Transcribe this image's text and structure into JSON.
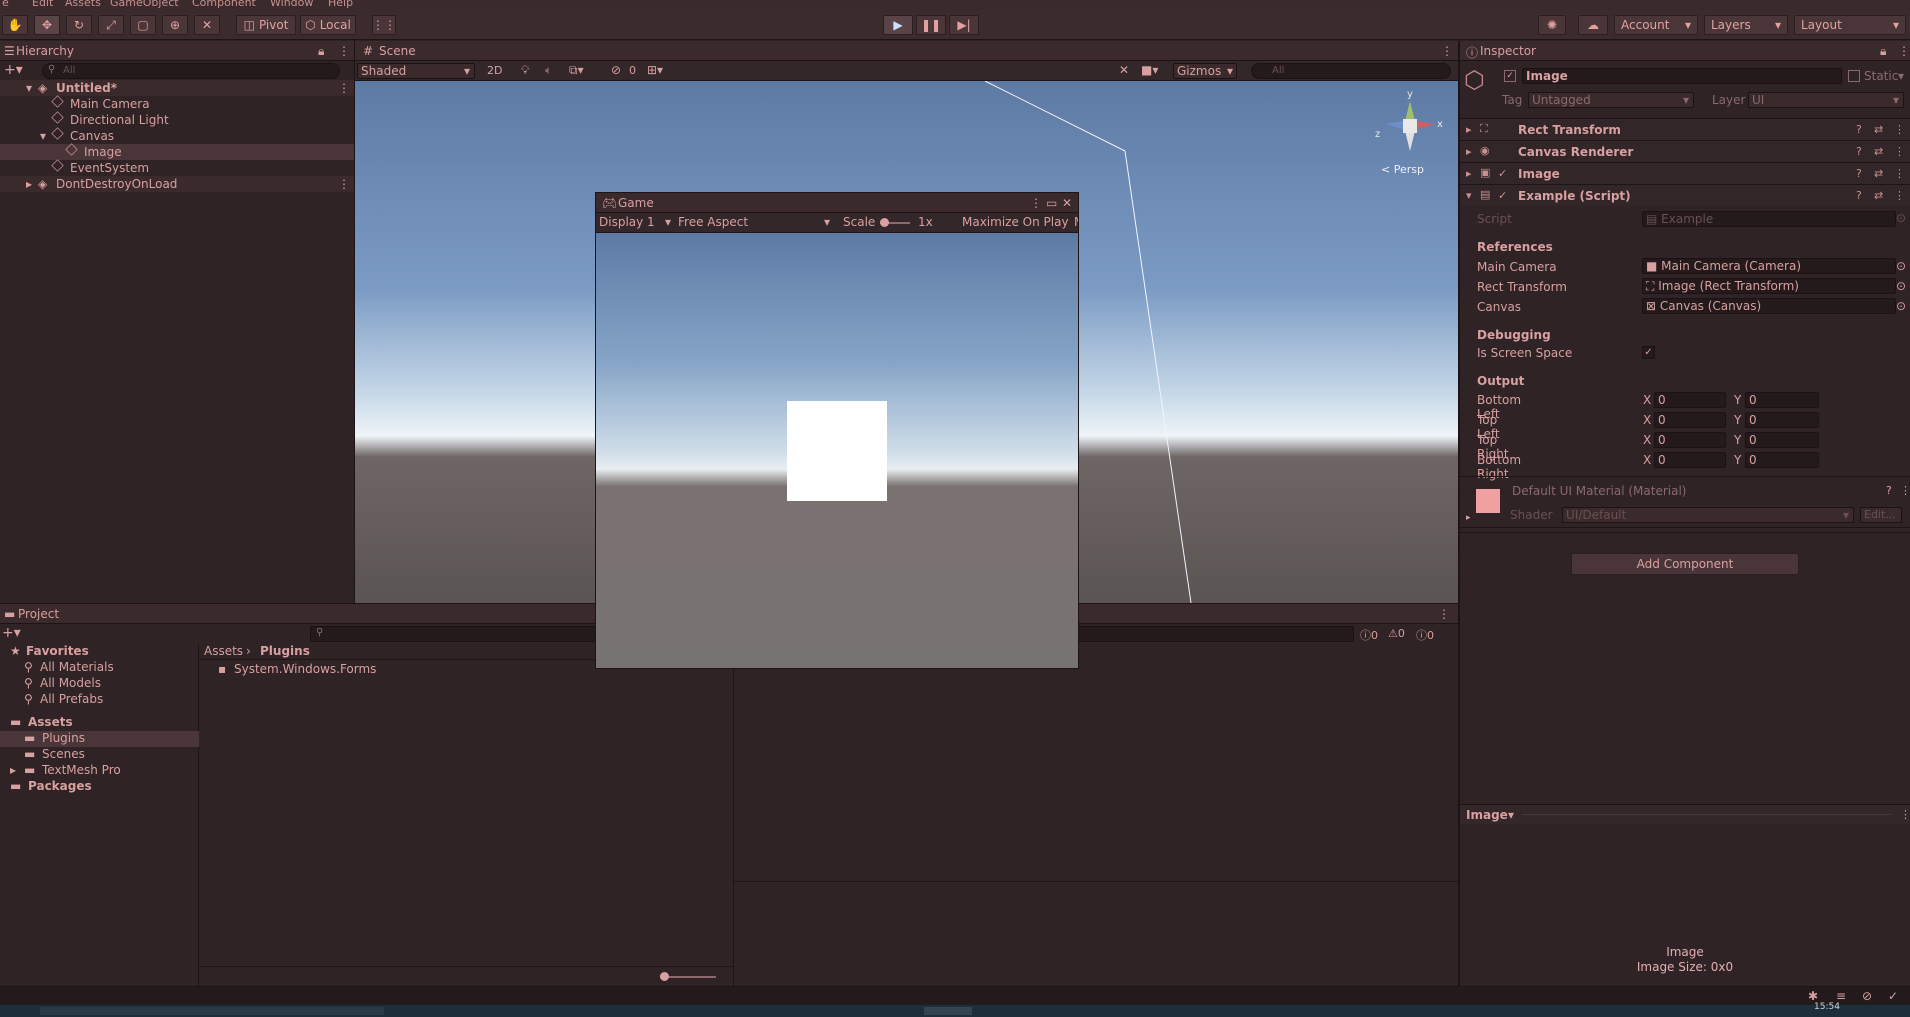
{
  "menu": [
    "e",
    "Edit",
    "Assets",
    "GameObject",
    "Component",
    "Window",
    "Help"
  ],
  "toolbar": {
    "pivot": "Pivot",
    "local": "Local",
    "account": "Account",
    "layers": "Layers",
    "layout": "Layout"
  },
  "hierarchy": {
    "title": "Hierarchy",
    "search_placeholder": "All",
    "items": [
      {
        "label": "Untitled*"
      },
      {
        "label": "Main Camera"
      },
      {
        "label": "Directional Light"
      },
      {
        "label": "Canvas"
      },
      {
        "label": "Image"
      },
      {
        "label": "EventSystem"
      },
      {
        "label": "DontDestroyOnLoad"
      }
    ]
  },
  "scene": {
    "title": "Scene",
    "shading": "Shaded",
    "mode_2d": "2D",
    "hidden_count": "0",
    "gizmos": "Gizmos",
    "search_placeholder": "All",
    "persp": "Persp",
    "axis_y": "y",
    "axis_x": "x",
    "axis_z": "z"
  },
  "game": {
    "title": "Game",
    "display": "Display 1",
    "aspect": "Free Aspect",
    "scale_label": "Scale",
    "scale_value": "1x",
    "maximize": "Maximize On Play",
    "overflow": "M"
  },
  "project": {
    "title": "Project",
    "favorites_label": "Favorites",
    "favorites": [
      "All Materials",
      "All Models",
      "All Prefabs"
    ],
    "assets_label": "Assets",
    "assets": [
      "Plugins",
      "Scenes",
      "TextMesh Pro"
    ],
    "packages_label": "Packages",
    "breadcrumb": [
      "Assets",
      "Plugins"
    ],
    "files": [
      "System.Windows.Forms"
    ],
    "console_counts": [
      "0",
      "0",
      "0"
    ]
  },
  "inspector": {
    "title": "Inspector",
    "object_name": "Image",
    "static_label": "Static",
    "tag_label": "Tag",
    "tag_value": "Untagged",
    "layer_label": "Layer",
    "layer_value": "UI",
    "components": [
      "Rect Transform",
      "Canvas Renderer",
      "Image",
      "Example (Script)"
    ],
    "script_label": "Script",
    "script_value": "Example",
    "references_header": "References",
    "refs": [
      {
        "label": "Main Camera",
        "value": "Main Camera (Camera)"
      },
      {
        "label": "Rect Transform",
        "value": "Image (Rect Transform)"
      },
      {
        "label": "Canvas",
        "value": "Canvas (Canvas)"
      }
    ],
    "debugging_header": "Debugging",
    "screen_space_label": "Is Screen Space",
    "output_header": "Output",
    "outputs": [
      {
        "label": "Bottom Left",
        "x": "0",
        "y": "0"
      },
      {
        "label": "Top Left",
        "x": "0",
        "y": "0"
      },
      {
        "label": "Top Right",
        "x": "0",
        "y": "0"
      },
      {
        "label": "Bottom Right",
        "x": "0",
        "y": "0"
      }
    ],
    "x_label": "X",
    "y_label": "Y",
    "material_name": "Default UI Material (Material)",
    "shader_label": "Shader",
    "shader_value": "UI/Default",
    "edit_label": "Edit...",
    "add_component": "Add Component",
    "preview_label": "Image",
    "preview_name": "Image",
    "preview_size": "Image Size: 0x0"
  },
  "status": {
    "time": "15:54"
  },
  "colors": {
    "accent": "#e4a0a0",
    "panel": "#2f2325",
    "material_swatch": "#f0a0a0"
  }
}
